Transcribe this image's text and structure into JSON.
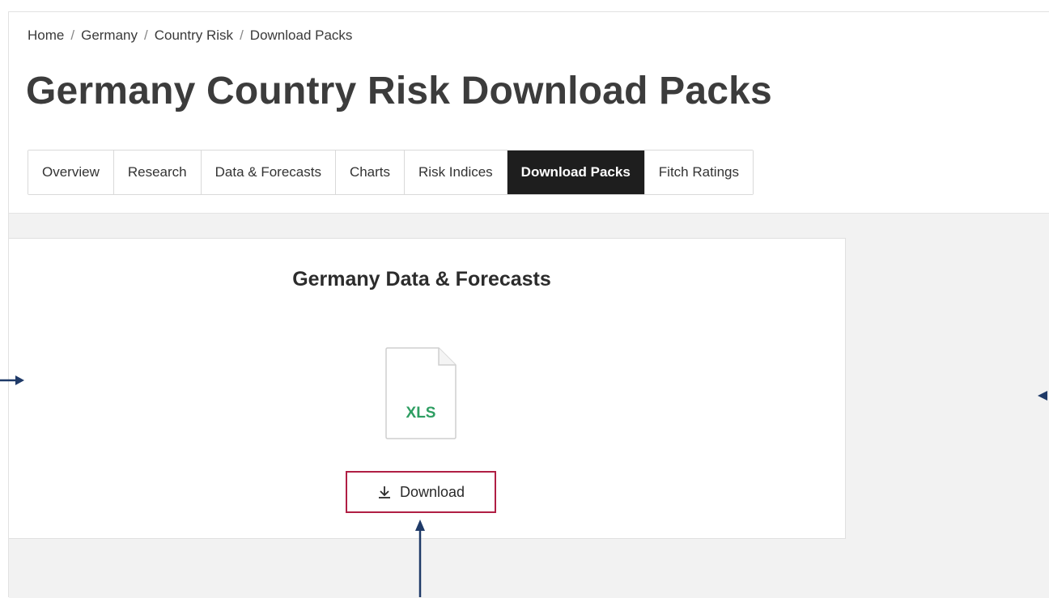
{
  "breadcrumb": {
    "items": [
      "Home",
      "Germany",
      "Country Risk",
      "Download Packs"
    ],
    "separator": "/"
  },
  "page_title": "Germany Country Risk Download Packs",
  "tabs": [
    {
      "label": "Overview",
      "active": false
    },
    {
      "label": "Research",
      "active": false
    },
    {
      "label": "Data & Forecasts",
      "active": false
    },
    {
      "label": "Charts",
      "active": false
    },
    {
      "label": "Risk Indices",
      "active": false
    },
    {
      "label": "Download Packs",
      "active": true
    },
    {
      "label": "Fitch Ratings",
      "active": false
    }
  ],
  "card": {
    "title": "Germany Data & Forecasts",
    "file_type": "XLS",
    "file_icon": "xls-file-icon",
    "download_label": "Download",
    "download_icon": "download-icon"
  },
  "colors": {
    "active_tab_bg": "#1e1e1e",
    "highlight_border": "#b01f44",
    "xls_green": "#2e9e62",
    "annotation_arrow": "#1f3a68",
    "page_grey": "#f2f2f2"
  }
}
